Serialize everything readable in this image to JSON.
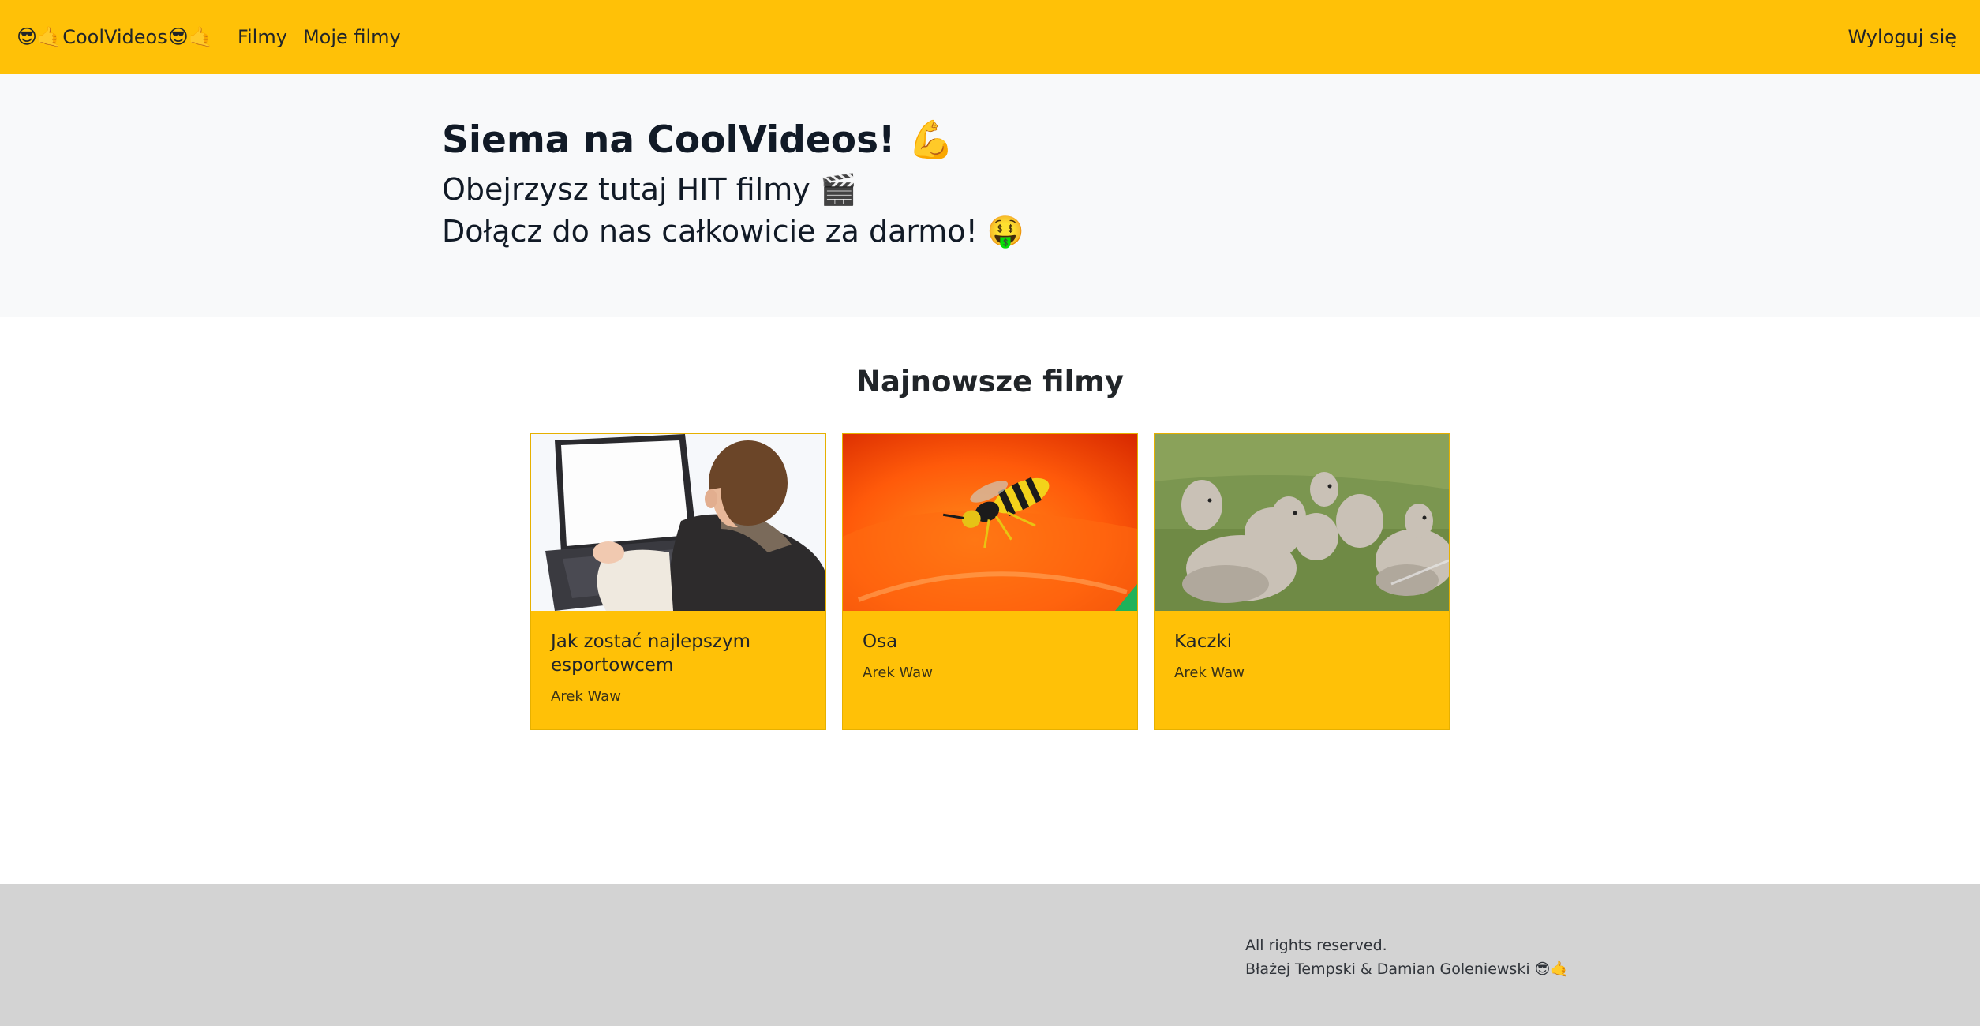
{
  "navbar": {
    "brand_prefix_emoji": "😎🤙",
    "brand_name": "CoolVideos",
    "brand_suffix_emoji": "😎🤙",
    "links": [
      {
        "label": "Filmy"
      },
      {
        "label": "Moje filmy"
      }
    ],
    "logout_label": "Wyloguj się",
    "background_color": "#FFC107"
  },
  "hero": {
    "title": "Siema na CoolVideos!",
    "title_emoji": "💪",
    "line1": "Obejrzysz tutaj HIT filmy",
    "line1_emoji": "🎬",
    "line2": "Dołącz do nas całkowicie za darmo!",
    "line2_emoji": "🤑"
  },
  "section": {
    "title": "Najnowsze filmy"
  },
  "videos": [
    {
      "title": "Jak zostać najlepszym esportowcem",
      "author": "Arek Waw",
      "thumbnail": "boy-on-laptop-thumbnail"
    },
    {
      "title": "Osa",
      "author": "Arek Waw",
      "thumbnail": "wasp-on-orange-petal-thumbnail"
    },
    {
      "title": "Kaczki",
      "author": "Arek Waw",
      "thumbnail": "ducklings-on-grass-thumbnail"
    }
  ],
  "footer": {
    "rights": "All rights reserved.",
    "authors": "Błażej Tempski & Damian Goleniewski",
    "authors_emoji": "😎🤙",
    "background_color": "#D3D3D3"
  }
}
